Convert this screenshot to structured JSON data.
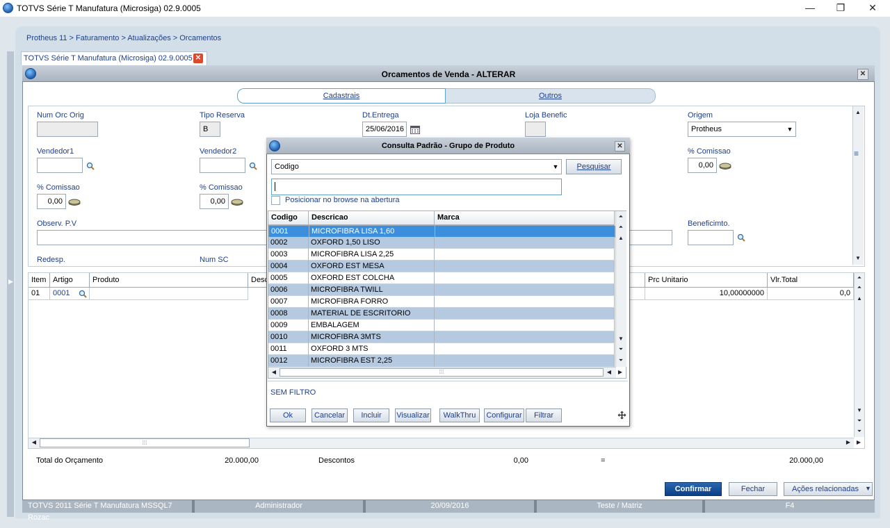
{
  "window": {
    "title": "TOTVS Série T Manufatura (Microsiga) 02.9.0005",
    "minimize": "—",
    "maximize": "❐",
    "close": "✕"
  },
  "breadcrumb": "Protheus 11 > Faturamento > Atualizações > Orcamentos",
  "tab": {
    "label": "TOTVS Série T Manufatura (Microsiga) 02.9.0005",
    "close": "✕"
  },
  "dialog": {
    "title": "Orcamentos de Venda - ALTERAR",
    "close": "✕",
    "segments": {
      "left": "Cadastrais",
      "right": "Outros"
    },
    "fields": {
      "num_orc_orig": {
        "label": "Num Orc Orig",
        "value": ""
      },
      "tipo_reserva": {
        "label": "Tipo Reserva",
        "value": "B"
      },
      "dt_entrega": {
        "label": "Dt.Entrega",
        "value": "25/06/2016"
      },
      "loja_benefic": {
        "label": "Loja Benefic",
        "value": ""
      },
      "origem": {
        "label": "Origem",
        "value": "Protheus"
      },
      "vendedor1": {
        "label": "Vendedor1",
        "value": ""
      },
      "vendedor2": {
        "label": "Vendedor2",
        "value": ""
      },
      "comissao_right": {
        "label": "% Comissao",
        "value": "0,00"
      },
      "comissao1": {
        "label": "% Comissao",
        "value": "0,00"
      },
      "comissao2": {
        "label": "% Comissao",
        "value": "0,00"
      },
      "observ_pv": {
        "label": "Observ. P.V",
        "value": ""
      },
      "beneficimto": {
        "label": "Beneficimto.",
        "value": ""
      },
      "redesp": {
        "label": "Redesp."
      },
      "num_sc": {
        "label": "Num SC"
      }
    },
    "grid": {
      "headers": {
        "item": "Item",
        "artigo": "Artigo",
        "produto": "Produto",
        "desc": "Desc",
        "prc_unitario": "Prc Unitario",
        "vlr_total": "Vlr.Total"
      },
      "row": {
        "item": "01",
        "artigo": "0001",
        "prc_unitario": "10,00000000",
        "vlr_total": "0,0"
      }
    },
    "totals": {
      "total_label": "Total do Orçamento",
      "total_value": "20.000,00",
      "desc_label": "Descontos",
      "desc_value": "0,00",
      "eq": "=",
      "final_value": "20.000,00"
    },
    "buttons": {
      "confirm": "Confirmar",
      "close": "Fechar",
      "actions": "Ações relacionadas"
    }
  },
  "statusbar": [
    "TOTVS 2011 Série T Manufatura MSSQL7 Rozac",
    "Administrador",
    "20/09/2016",
    "Teste / Matriz",
    "F4"
  ],
  "modal": {
    "title": "Consulta Padrão - Grupo de Produto",
    "close": "✕",
    "order_select": "Codigo",
    "search_button": "Pesquisar",
    "search_value": "",
    "checkbox_label": "Posicionar no browse na abertura",
    "columns": {
      "codigo": "Codigo",
      "descricao": "Descricao",
      "marca": "Marca"
    },
    "rows": [
      {
        "codigo": "0001",
        "descricao": "MICROFIBRA LISA 1,60",
        "marca": ""
      },
      {
        "codigo": "0002",
        "descricao": "OXFORD 1,50 LISO",
        "marca": ""
      },
      {
        "codigo": "0003",
        "descricao": "MICROFIBRA LISA 2,25",
        "marca": ""
      },
      {
        "codigo": "0004",
        "descricao": "OXFORD EST MESA",
        "marca": ""
      },
      {
        "codigo": "0005",
        "descricao": "OXFORD EST COLCHA",
        "marca": ""
      },
      {
        "codigo": "0006",
        "descricao": "MICROFIBRA TWILL",
        "marca": ""
      },
      {
        "codigo": "0007",
        "descricao": "MICROFIBRA FORRO",
        "marca": ""
      },
      {
        "codigo": "0008",
        "descricao": "MATERIAL DE ESCRITORIO",
        "marca": ""
      },
      {
        "codigo": "0009",
        "descricao": "EMBALAGEM",
        "marca": ""
      },
      {
        "codigo": "0010",
        "descricao": "MICROFIBRA 3MTS",
        "marca": ""
      },
      {
        "codigo": "0011",
        "descricao": "OXFORD 3 MTS",
        "marca": ""
      },
      {
        "codigo": "0012",
        "descricao": "MICROFIBRA EST 2,25",
        "marca": ""
      }
    ],
    "filter_text": "SEM FILTRO",
    "buttons": {
      "ok": "Ok",
      "cancel": "Cancelar",
      "include": "Incluir",
      "view": "Visualizar",
      "walkthru": "WalkThru",
      "configure": "Configurar",
      "filter": "Filtrar"
    }
  }
}
